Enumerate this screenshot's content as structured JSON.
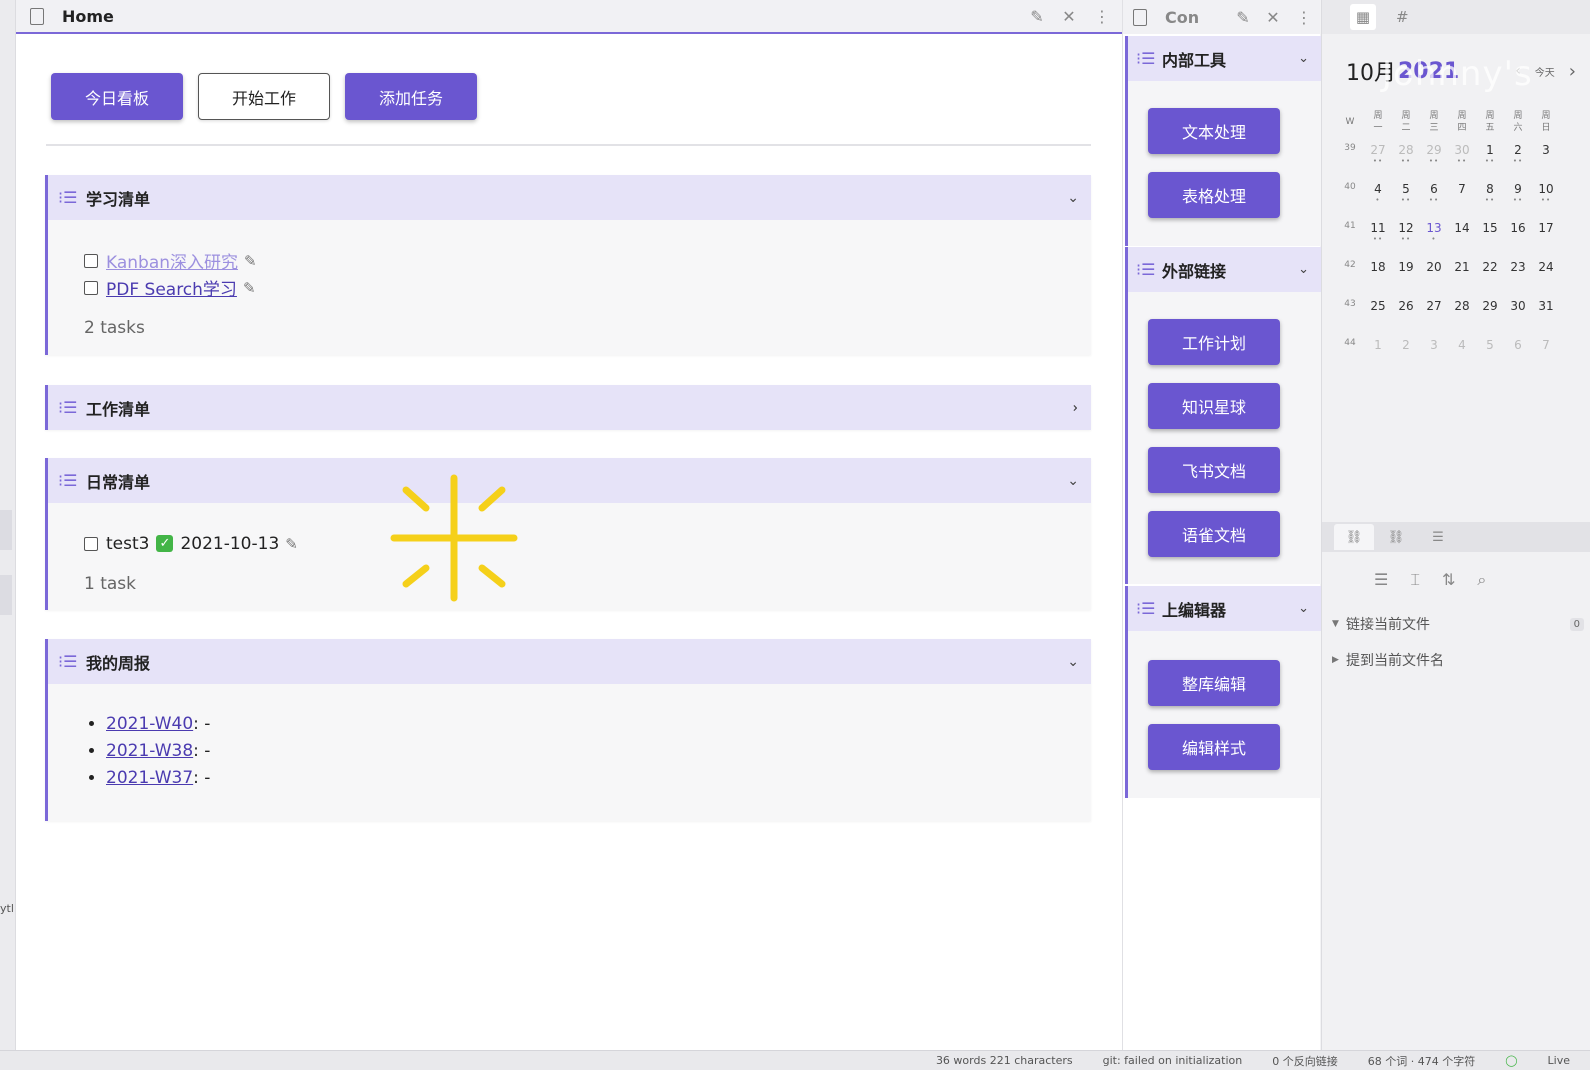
{
  "left_strip": {
    "text": "ytl"
  },
  "main": {
    "tab_title": "Home",
    "buttons": {
      "today_board": "今日看板",
      "start_work": "开始工作",
      "add_task": "添加任务"
    },
    "study_list": {
      "title": "学习清单",
      "tasks": [
        "Kanban深入研究",
        "PDF Search学习"
      ],
      "count": "2 tasks"
    },
    "work_list": {
      "title": "工作清单"
    },
    "daily_list": {
      "title": "日常清单",
      "task_name": "test3",
      "task_date": "2021-10-13",
      "count": "1 task"
    },
    "weekly": {
      "title": "我的周报",
      "items": [
        "2021-W40",
        "2021-W38",
        "2021-W37"
      ],
      "suffix": ": -"
    }
  },
  "mid": {
    "tab_title": "Con",
    "sections": {
      "internal": {
        "title": "内部工具",
        "buttons": [
          "文本处理",
          "表格处理"
        ]
      },
      "external": {
        "title": "外部链接",
        "buttons": [
          "工作计划",
          "知识星球",
          "飞书文档",
          "语雀文档"
        ]
      },
      "editor": {
        "title": "上编辑器",
        "buttons": [
          "整库编辑",
          "编辑样式"
        ]
      }
    }
  },
  "right": {
    "calendar": {
      "month": "10月",
      "year": "2021",
      "watermark": "Johnny's",
      "week_label": "W",
      "weekdays": [
        "一",
        "二",
        "三",
        "四",
        "五",
        "六",
        "日"
      ],
      "weekday_prefix": "周",
      "today_label": "今天",
      "weeks": [
        {
          "wk": "39",
          "days": [
            "27",
            "28",
            "29",
            "30",
            "1",
            "2",
            "3"
          ]
        },
        {
          "wk": "40",
          "days": [
            "4",
            "5",
            "6",
            "7",
            "8",
            "9",
            "10"
          ]
        },
        {
          "wk": "41",
          "days": [
            "11",
            "12",
            "13",
            "14",
            "15",
            "16",
            "17"
          ]
        },
        {
          "wk": "42",
          "days": [
            "18",
            "19",
            "20",
            "21",
            "22",
            "23",
            "24"
          ]
        },
        {
          "wk": "43",
          "days": [
            "25",
            "26",
            "27",
            "28",
            "29",
            "30",
            "31"
          ]
        },
        {
          "wk": "44",
          "days": [
            "1",
            "2",
            "3",
            "4",
            "5",
            "6",
            "7"
          ]
        }
      ]
    },
    "backlinks": {
      "linked": "链接当前文件",
      "linked_count": "0",
      "unlinked": "提到当前文件名"
    }
  },
  "statusbar": {
    "words": "36 words 221 characters",
    "git": "git: failed on initialization",
    "backlinks": "0 个反向链接",
    "counts": "68 个词 · 474 个字符",
    "mode": "Live"
  },
  "colors": {
    "accent": "#6a56d0",
    "callout_head": "#e6e3f8",
    "callout_border": "#7b68d8"
  }
}
